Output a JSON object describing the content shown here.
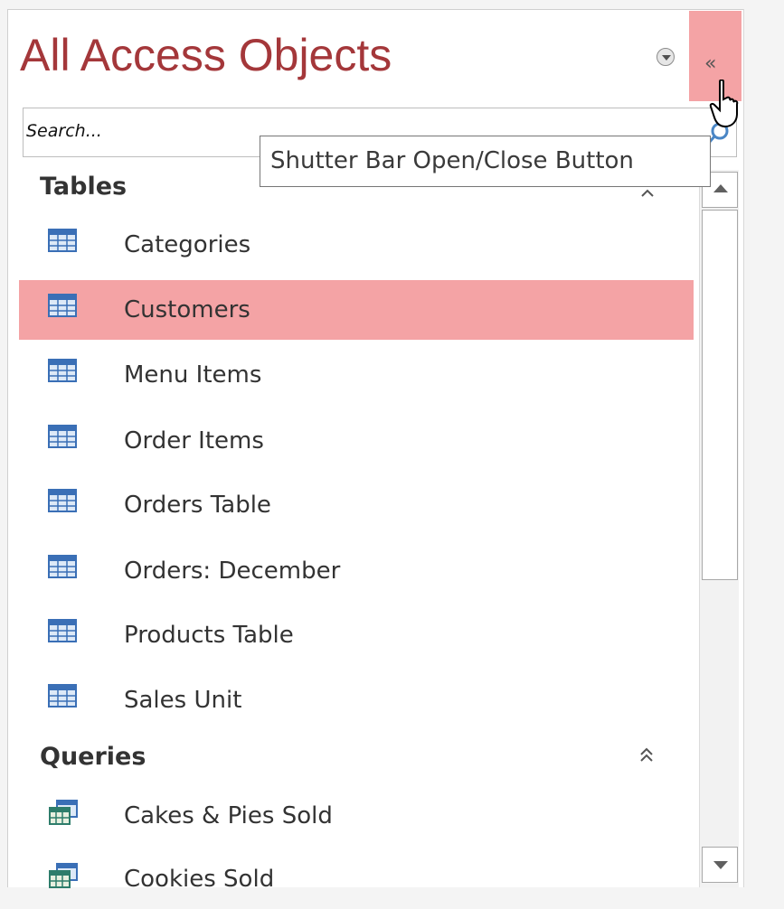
{
  "nav_pane": {
    "title": "All Access Objects",
    "menu_icon": "chevron-down-circle-icon",
    "shutter_label": "«",
    "shutter_icon": "double-chevron-left-icon",
    "search": {
      "placeholder": "Search...",
      "value": "",
      "icon": "search-icon"
    },
    "tooltip": "Shutter Bar Open/Close Button",
    "groups": [
      {
        "name": "Tables",
        "chevron": "⌃",
        "items": [
          {
            "label": "Categories",
            "icon": "table-icon",
            "selected": false
          },
          {
            "label": "Customers",
            "icon": "table-icon",
            "selected": true
          },
          {
            "label": "Menu Items",
            "icon": "table-icon",
            "selected": false
          },
          {
            "label": "Order Items",
            "icon": "table-icon",
            "selected": false
          },
          {
            "label": "Orders Table",
            "icon": "table-icon",
            "selected": false
          },
          {
            "label": "Orders: December",
            "icon": "table-icon",
            "selected": false
          },
          {
            "label": "Products Table",
            "icon": "table-icon",
            "selected": false
          },
          {
            "label": "Sales Unit",
            "icon": "table-icon",
            "selected": false
          }
        ]
      },
      {
        "name": "Queries",
        "chevron": "⌃⌃",
        "items": [
          {
            "label": "Cakes & Pies Sold",
            "icon": "query-icon",
            "selected": false
          },
          {
            "label": "Cookies Sold",
            "icon": "query-icon",
            "selected": false
          }
        ]
      }
    ]
  },
  "colors": {
    "title": "#a4373a",
    "selection": "#f4a3a5",
    "text": "#333333"
  }
}
